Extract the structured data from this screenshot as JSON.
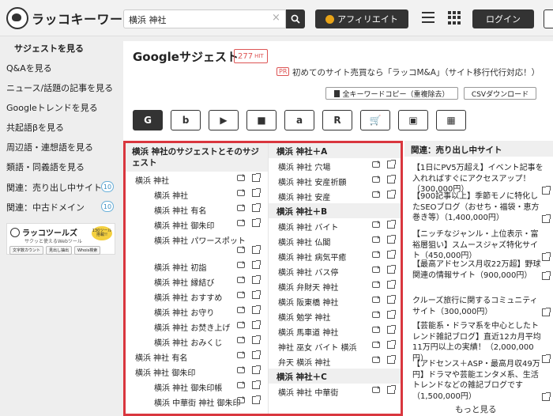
{
  "header": {
    "logo_text": "ラッコキーワード",
    "search_value": "横浜 神社",
    "clear_glyph": "×",
    "affiliate_label": "アフィリエイト",
    "login_label": "ログイン"
  },
  "sidebar": {
    "items": [
      {
        "label": "サジェストを見る"
      },
      {
        "label": "Q&Aを見る"
      },
      {
        "label": "ニュース/話題の記事を見る"
      },
      {
        "label": "Googleトレンドを見る"
      },
      {
        "label": "共起語βを見る"
      },
      {
        "label": "周辺語・連想語を見る"
      },
      {
        "label": "類語・同義語を見る"
      },
      {
        "label": "関連：売り出し中サイト",
        "badge": "10"
      },
      {
        "label": "関連：中古ドメイン",
        "badge": "10"
      }
    ],
    "tools_banner": {
      "title": "ラッコツールズ",
      "subtitle": "サクッと使えるWebツール",
      "badge": "130ツール 搭載!!",
      "chips": [
        "文字数カウント",
        "見出し抽出",
        "Whois検索"
      ]
    }
  },
  "main": {
    "title": "Googleサジェスト",
    "hit_count": "277",
    "hit_unit": "HIT",
    "pr_tag": "PR",
    "pr_text": "初めてのサイト売買なら「ラッコM&A」（サイト移行代行対応！）",
    "copy_button": "全キーワードコピー（重複除去）",
    "csv_button": "CSVダウンロード",
    "engines": [
      {
        "name": "google",
        "glyph": "G"
      },
      {
        "name": "bing",
        "glyph": "b"
      },
      {
        "name": "youtube",
        "glyph": "▶"
      },
      {
        "name": "video",
        "glyph": "■"
      },
      {
        "name": "amazon",
        "glyph": "a"
      },
      {
        "name": "rakuten",
        "glyph": "R"
      },
      {
        "name": "shopping",
        "glyph": "🛒"
      },
      {
        "name": "image",
        "glyph": "▣"
      },
      {
        "name": "apps",
        "glyph": "▦"
      }
    ]
  },
  "suggest": {
    "col_a_title": "横浜 神社のサジェストとそのサジェスト",
    "col_a_rows": [
      {
        "kw": "横浜 神社",
        "indent": 0
      },
      {
        "kw": "横浜 神社",
        "indent": 1
      },
      {
        "kw": "横浜 神社 有名",
        "indent": 1
      },
      {
        "kw": "横浜 神社 御朱印",
        "indent": 1
      },
      {
        "kw": "横浜 神社 パワースポット",
        "indent": 1,
        "wrap": true
      },
      {
        "kw": "横浜 神社 初詣",
        "indent": 1
      },
      {
        "kw": "横浜 神社 縁結び",
        "indent": 1
      },
      {
        "kw": "横浜 神社 おすすめ",
        "indent": 1
      },
      {
        "kw": "横浜 神社 お守り",
        "indent": 1
      },
      {
        "kw": "横浜 神社 お焚き上げ",
        "indent": 1
      },
      {
        "kw": "横浜 神社 おみくじ",
        "indent": 1
      },
      {
        "kw": "横浜 神社 有名",
        "indent": 0
      },
      {
        "kw": "横浜 神社 御朱印",
        "indent": 0
      },
      {
        "kw": "横浜 神社 御朱印帳",
        "indent": 1
      },
      {
        "kw": "横浜 中華街 神社 御朱印",
        "indent": 1
      }
    ],
    "groups": [
      {
        "title": "横浜 神社＋A",
        "rows": [
          "横浜 神社 穴場",
          "横浜 神社 安産祈願",
          "横浜 神社 安産"
        ]
      },
      {
        "title": "横浜 神社＋B",
        "rows": [
          "横浜 神社 バイト",
          "横浜 神社 仏閣",
          "横浜 神社 病気平癒",
          "横浜 神社 バス停",
          "横浜 弁財天 神社",
          "横浜 阪東橋 神社",
          "横浜 勉学 神社",
          "横浜 馬車道 神社",
          "神社 巫女 バイト 横浜",
          "弁天 横浜 神社"
        ]
      },
      {
        "title": "横浜 神社＋C",
        "rows": [
          "横浜 神社 中華街"
        ]
      }
    ]
  },
  "related": {
    "title": "関連：売り出し中サイト",
    "items": [
      "【1日にPV5万超え】イベント記事を入れればすぐにアクセスアップ！（300,000円）",
      "【900記事以上】季節モノに特化したSEOブログ（おせち・福袋・恵方巻き等）（1,400,000円）",
      "【ニッチなジャンル・上位表示・富裕層狙い】スムースジャズ特化サイト（450,000円）",
      "【最高アドセンス月収22万超】野球関連の情報サイト（900,000円）",
      "クルーズ旅行に関するコミュニティサイト（300,000円）",
      "【芸能系・ドラマ系を中心としたトレンド雑記ブログ】直近12カ月平均11万円以上の実績！（2,000,000円）",
      "【アドセンス＋ASP・最高月収49万円】ドラマや芸能エンタメ系、生活トレンドなどの雑記ブログです（1,500,000円）"
    ],
    "more_label": "もっと見る"
  }
}
